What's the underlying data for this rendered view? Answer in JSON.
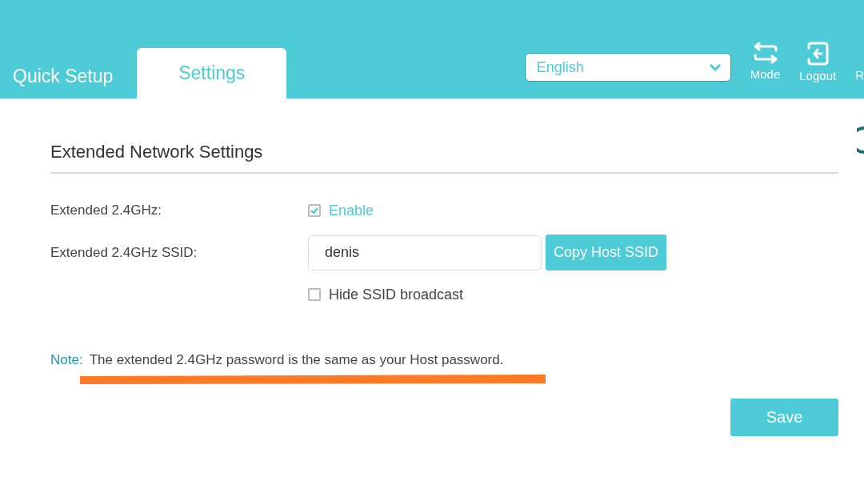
{
  "tabs": [
    {
      "label": "Quick Setup",
      "selected": false
    },
    {
      "label": "Settings",
      "selected": true
    }
  ],
  "language": {
    "value": "English"
  },
  "toolbar": [
    {
      "kind": "mode",
      "label": "Mode"
    },
    {
      "kind": "logout",
      "label": "Logout"
    },
    {
      "kind": "cut",
      "label": "R"
    }
  ],
  "section": {
    "title": "Extended Network Settings"
  },
  "fields": [
    {
      "kind": "checkbox",
      "label": "Extended 2.4GHz:",
      "option": "Enable",
      "checked": true
    },
    {
      "kind": "text",
      "label": "Extended 2.4GHz SSID:",
      "value": "denis",
      "button": "Copy Host SSID"
    },
    {
      "kind": "checkbox",
      "option": "Hide SSID broadcast",
      "checked": false
    }
  ],
  "note": {
    "label": "Note:",
    "text": "The extended 2.4GHz password is the same as your Host password."
  },
  "save_button": "Save"
}
